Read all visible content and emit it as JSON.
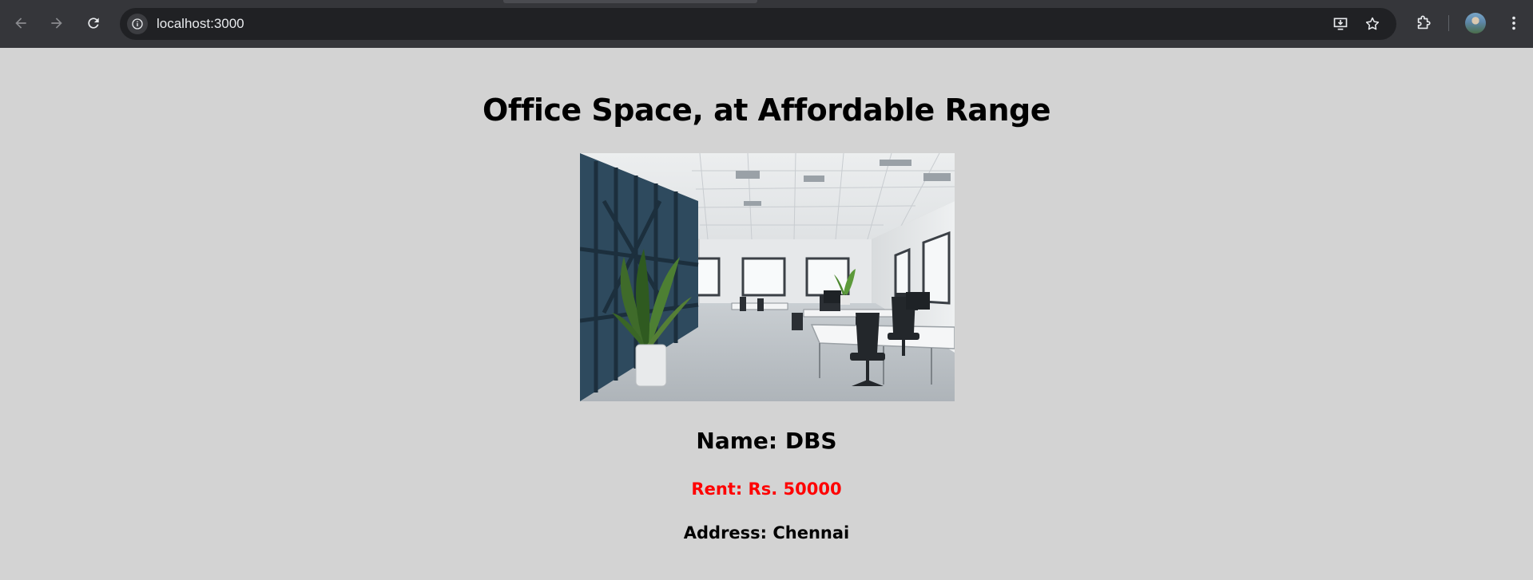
{
  "browser": {
    "url": "localhost:3000"
  },
  "colors": {
    "page_background": "#d3d3d3",
    "rent_color": "#ff0000",
    "chrome_background": "#35363a"
  },
  "page": {
    "heading": "Office Space, at Affordable Range",
    "image_alt": "office-photo",
    "name_text": "Name: DBS",
    "rent_text": "Rent: Rs. 50000",
    "address_text": "Address: Chennai"
  },
  "icons": {
    "back": "back-arrow-icon",
    "forward": "forward-arrow-icon",
    "reload": "reload-icon",
    "site_info": "info-icon",
    "install": "install-app-icon",
    "bookmark": "star-icon",
    "extensions": "puzzle-icon",
    "profile": "avatar",
    "menu": "kebab-menu-icon"
  }
}
